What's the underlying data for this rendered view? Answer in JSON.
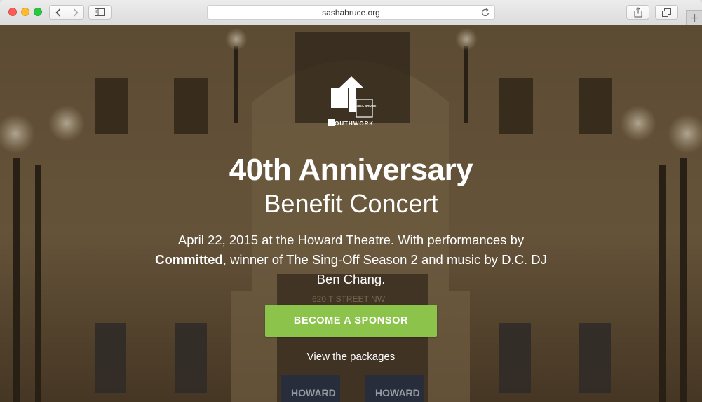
{
  "browser": {
    "url": "sashabruce.org",
    "icons": {
      "back": "chevron-left-icon",
      "forward": "chevron-right-icon",
      "sidebar": "sidebar-icon",
      "reload": "reload-icon",
      "share": "share-icon",
      "tabs": "tabs-overview-icon",
      "new_tab": "plus-icon"
    }
  },
  "hero": {
    "logo": {
      "brand_small": "SASHA BRUCE",
      "brand_main": "YOUTHWORK"
    },
    "title": "40th Anniversary",
    "subtitle": "Benefit Concert",
    "description": {
      "part1": "April 22, 2015 at the Howard Theatre. With performances by ",
      "bold": "Committed",
      "part2": ", winner of The Sing-Off Season 2 and music by D.C. DJ Ben Chang."
    },
    "background_signage": [
      "620 T STREET NW",
      "HOWARD",
      "HOWARD"
    ],
    "cta_label": "BECOME A SPONSOR",
    "link_label": "View the packages"
  },
  "colors": {
    "cta": "#8cc34a",
    "text": "#ffffff",
    "traffic_red": "#fc5f57",
    "traffic_yellow": "#fdbc2e",
    "traffic_green": "#29c840"
  }
}
